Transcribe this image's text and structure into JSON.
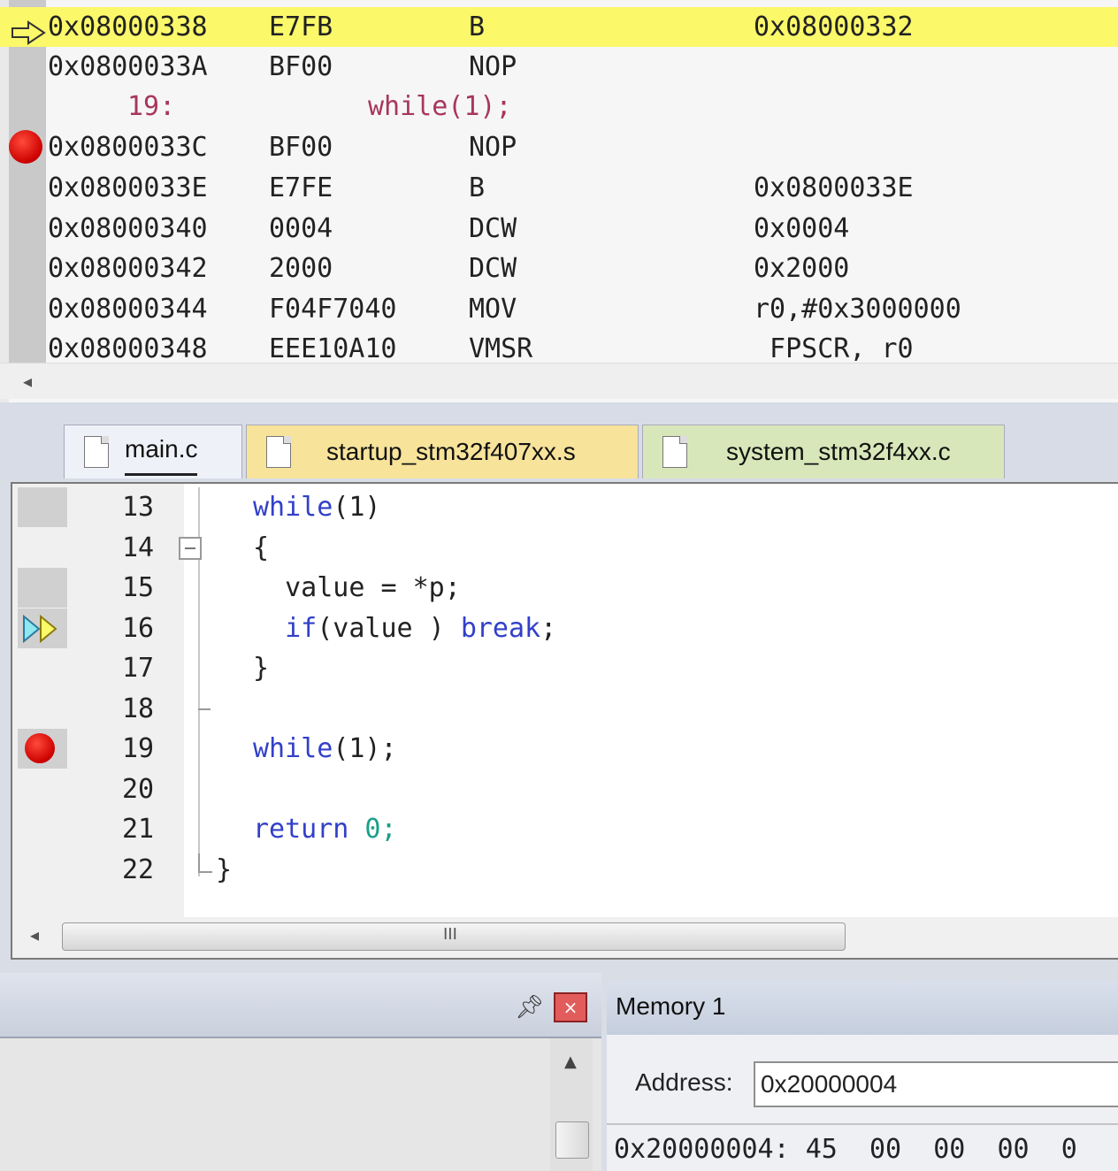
{
  "disassembly": {
    "rows": [
      {
        "type": "instr",
        "address": "0x08000338",
        "opcode": "E7FB",
        "mnemonic": "B",
        "operand": "0x08000332",
        "current": true
      },
      {
        "type": "instr",
        "address": "0x0800033A",
        "opcode": "BF00",
        "mnemonic": "NOP",
        "operand": ""
      },
      {
        "type": "source",
        "line": "19:",
        "text": "while(1);"
      },
      {
        "type": "instr",
        "address": "0x0800033C",
        "opcode": "BF00",
        "mnemonic": "NOP",
        "operand": "",
        "breakpoint": true
      },
      {
        "type": "instr",
        "address": "0x0800033E",
        "opcode": "E7FE",
        "mnemonic": "B",
        "operand": "0x0800033E"
      },
      {
        "type": "instr",
        "address": "0x08000340",
        "opcode": "0004",
        "mnemonic": "DCW",
        "operand": "0x0004"
      },
      {
        "type": "instr",
        "address": "0x08000342",
        "opcode": "2000",
        "mnemonic": "DCW",
        "operand": "0x2000"
      },
      {
        "type": "instr",
        "address": "0x08000344",
        "opcode": "F04F7040",
        "mnemonic": "MOV",
        "operand": "r0,#0x3000000"
      },
      {
        "type": "instr",
        "address": "0x08000348",
        "opcode": "EEE10A10",
        "mnemonic": "VMSR",
        "operand": " FPSCR, r0"
      }
    ]
  },
  "tabs": [
    {
      "label": "main.c",
      "active": true
    },
    {
      "label": "startup_stm32f407xx.s"
    },
    {
      "label": "system_stm32f4xx.c"
    }
  ],
  "editor": {
    "lines": [
      {
        "n": "13",
        "kw": "while",
        "rest": "(1)"
      },
      {
        "n": "14",
        "code": "{"
      },
      {
        "n": "15",
        "code": "  value = *p;"
      },
      {
        "n": "16",
        "kw": "  if",
        "mid": "(value ) ",
        "kw2": "break",
        "tail": ";"
      },
      {
        "n": "17",
        "code": "}"
      },
      {
        "n": "18",
        "code": ""
      },
      {
        "n": "19",
        "kw": "while",
        "rest": "(1);"
      },
      {
        "n": "20",
        "code": ""
      },
      {
        "n": "21",
        "kw": "return",
        "rest": " 0;"
      },
      {
        "n": "22",
        "code": "}"
      }
    ],
    "scroll_grip": "III"
  },
  "bottom_left": {
    "pin_icon": "ᴪ",
    "close_icon": "×"
  },
  "memory": {
    "title": "Memory 1",
    "address_label": "Address:",
    "address_value": "0x20000004",
    "line": "0x20000004: 45  00  00  00  0"
  },
  "colors": {
    "current_line": "#fbf86a",
    "keyword": "#3240c8",
    "source_line": "#a8365c",
    "breakpoint": "#cc0000"
  }
}
